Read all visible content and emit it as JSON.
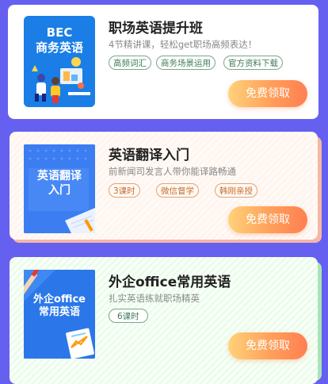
{
  "courses": [
    {
      "thumb_title_line1": "BEC",
      "thumb_title_line2": "商务英语",
      "title": "职场英语提升班",
      "subtitle": "4节精讲课，轻松get职场高频表达！",
      "tags": [
        "高频词汇",
        "商务场景运用",
        "官方资料下载"
      ],
      "button_label": "免费领取"
    },
    {
      "thumb_title_line1": "英语翻译",
      "thumb_title_line2": "入门",
      "title": "英语翻译入门",
      "subtitle": "前新闻司发言人带你能译路畅通",
      "tags": [
        "3课时",
        "微信督学",
        "韩刚亲授"
      ],
      "button_label": "免费领取"
    },
    {
      "thumb_title_line1": "外企office",
      "thumb_title_line2": "常用英语",
      "title": "外企office常用英语",
      "subtitle": "扎实英语练就职场精英",
      "tags": [
        "6课时"
      ],
      "button_label": "免费领取"
    }
  ],
  "colors": {
    "background": "#6560f0",
    "button_gradient_start": "#ffd27a",
    "button_gradient_end": "#ff7f52"
  }
}
